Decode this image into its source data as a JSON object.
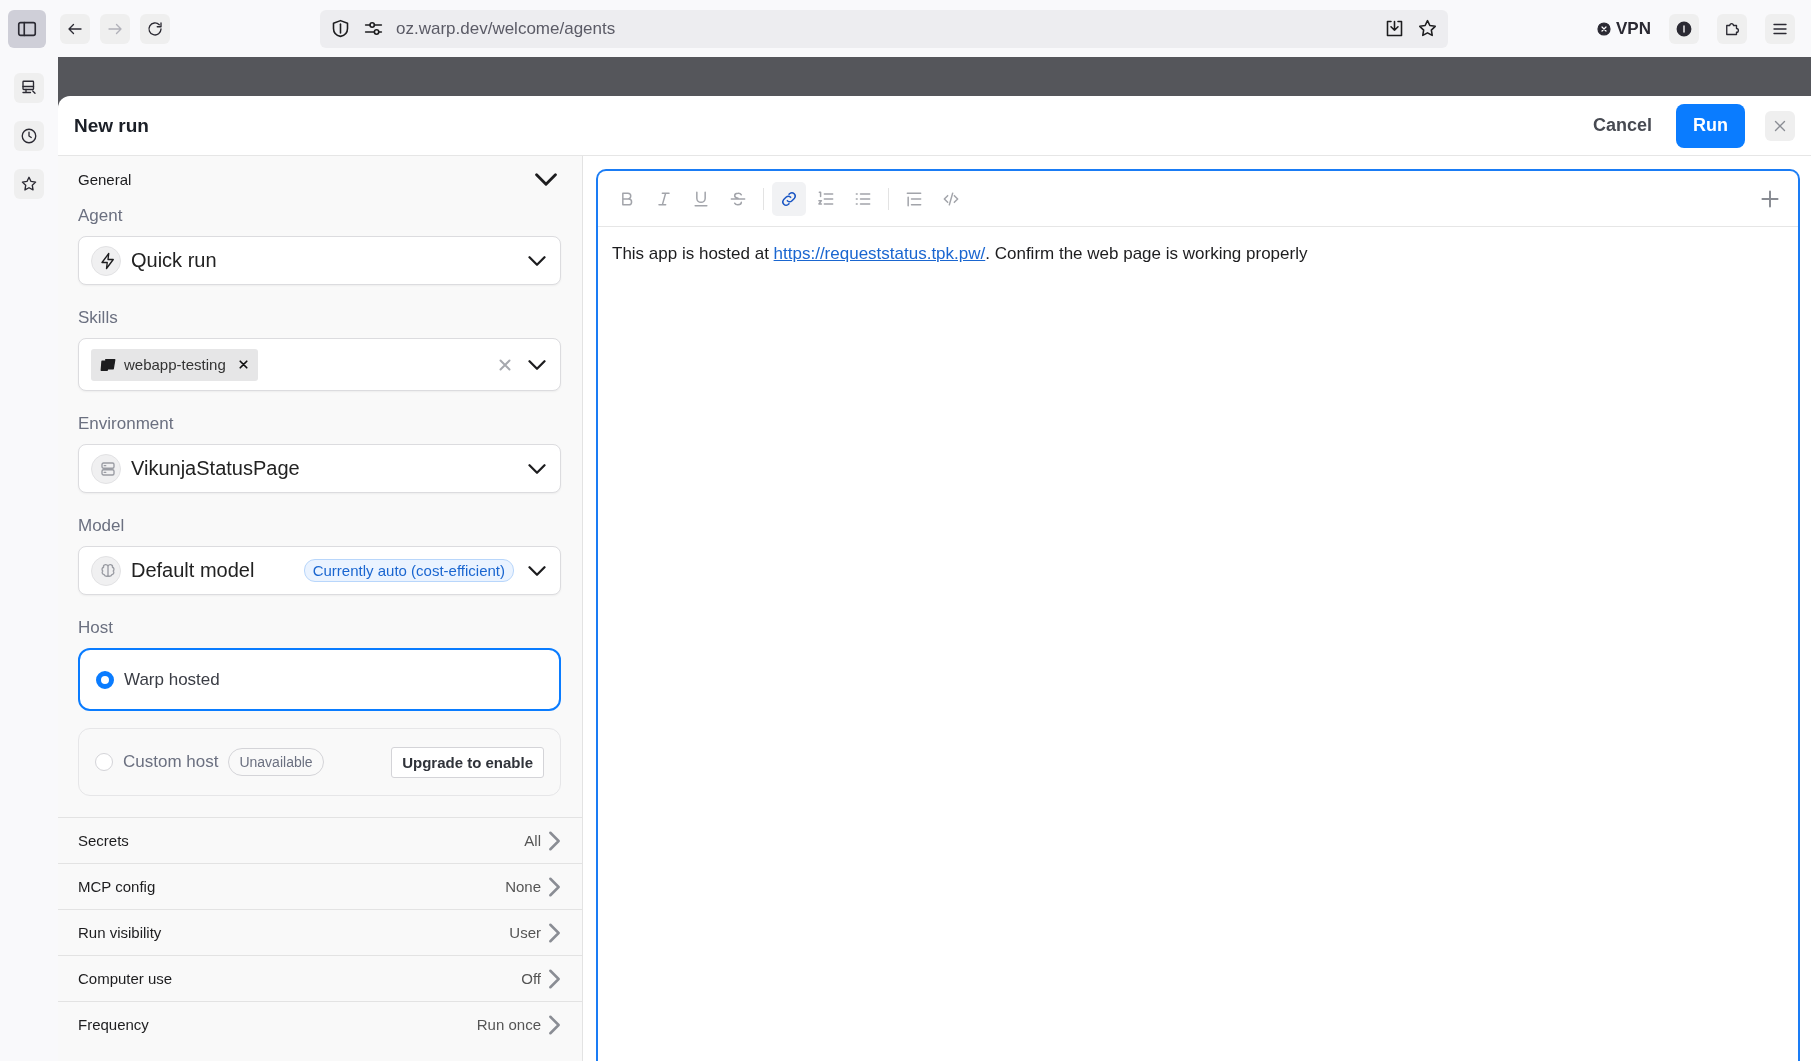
{
  "browser": {
    "url": "oz.warp.dev/welcome/agents",
    "forward_disabled": true,
    "vpn": "VPN"
  },
  "modal": {
    "title": "New run",
    "cancel": "Cancel",
    "run": "Run"
  },
  "general": {
    "title": "General",
    "expanded": true,
    "fields": [
      {
        "kind": "select",
        "label": "Agent",
        "value": "Quick run"
      },
      {
        "kind": "tags",
        "label": "Skills",
        "tags": [
          "webapp-testing"
        ]
      },
      {
        "kind": "select",
        "label": "Environment",
        "value": "VikunjaStatusPage"
      },
      {
        "kind": "select",
        "label": "Model",
        "value": "Default model",
        "badge": "Currently auto (cost-efficient)"
      }
    ]
  },
  "host": {
    "label": "Host",
    "options": [
      {
        "label": "Warp hosted",
        "selected": true,
        "disabled": false
      },
      {
        "label": "Custom host",
        "selected": false,
        "disabled": true,
        "badge": "Unavailable",
        "action": "Upgrade to enable"
      }
    ]
  },
  "settings": [
    {
      "label": "Secrets",
      "value": "All"
    },
    {
      "label": "MCP config",
      "value": "None"
    },
    {
      "label": "Run visibility",
      "value": "User"
    },
    {
      "label": "Computer use",
      "value": "Off"
    },
    {
      "label": "Frequency",
      "value": "Run once"
    }
  ],
  "editor": {
    "toolbar": [
      [
        {
          "kind": "bold",
          "active": false
        },
        {
          "kind": "italic",
          "active": false
        },
        {
          "kind": "underline",
          "active": false
        },
        {
          "kind": "strike",
          "active": false
        }
      ],
      [
        {
          "kind": "link",
          "active": true
        },
        {
          "kind": "ordered",
          "active": false
        },
        {
          "kind": "bullet",
          "active": false
        }
      ],
      [
        {
          "kind": "indent",
          "active": false
        },
        {
          "kind": "code",
          "active": false
        }
      ]
    ],
    "text_before": "This app is hosted at ",
    "link": "https://requeststatus.tpk.pw/",
    "text_after": ". Confirm the web page is working properly"
  }
}
